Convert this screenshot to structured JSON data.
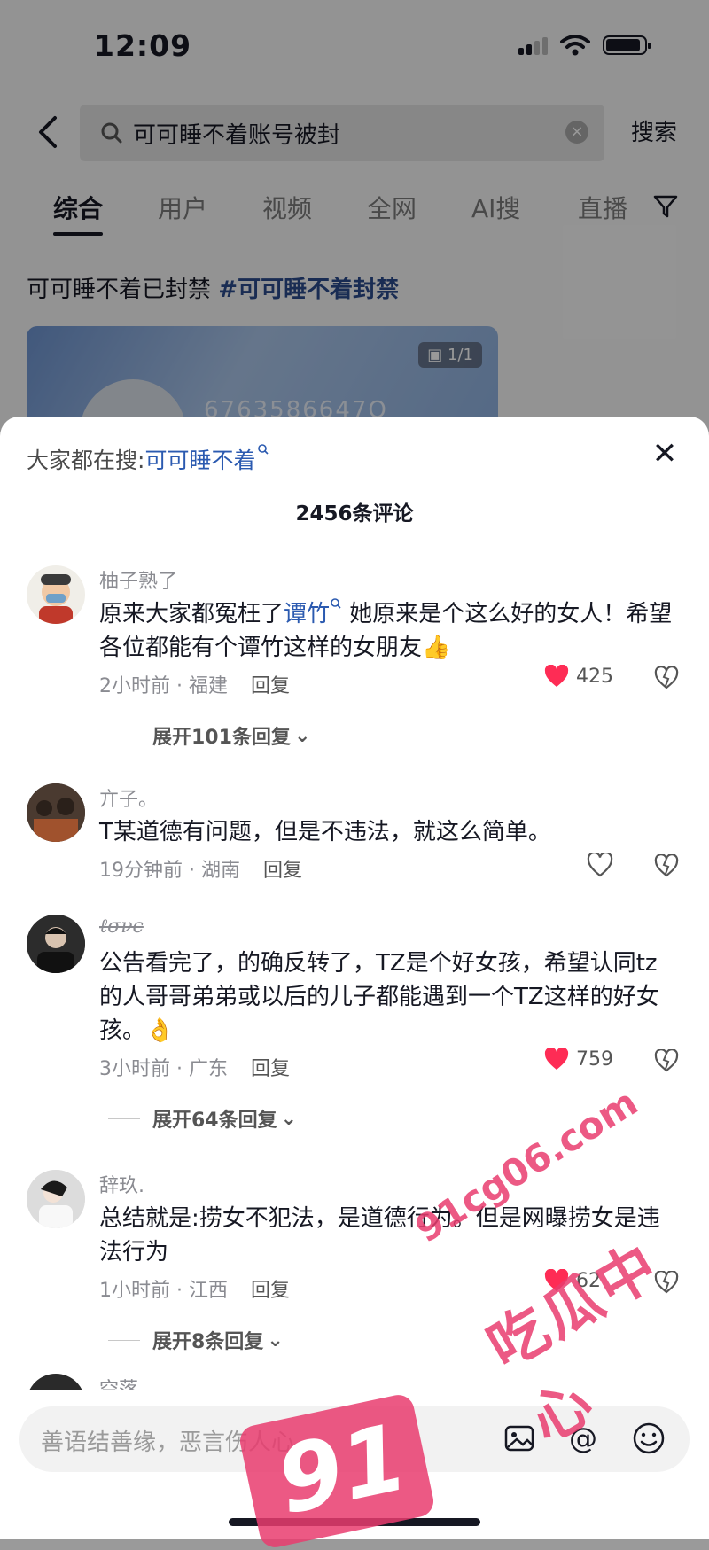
{
  "status_bar": {
    "time": "12:09"
  },
  "search": {
    "query": "可可睡不着账号被封",
    "submit_label": "搜索"
  },
  "tabs": [
    {
      "label": "综合"
    },
    {
      "label": "用户"
    },
    {
      "label": "视频"
    },
    {
      "label": "全网"
    },
    {
      "label": "AI搜"
    },
    {
      "label": "直播"
    }
  ],
  "background_post": {
    "text": "可可睡不着已封禁",
    "hashtag": "#可可睡不着封禁",
    "image_badge": "1/1",
    "image_number": "6763586647Q"
  },
  "sheet": {
    "trending_prefix": "大家都在搜:",
    "trending_keyword": "可可睡不着",
    "comment_count": "2456条评论"
  },
  "comments": [
    {
      "name": "柚子熟了",
      "text_before": "原来大家都冤枉了",
      "link": "谭竹",
      "text_after": " 她原来是个这么好的女人！希望各位都能有个谭竹这样的女朋友👍",
      "meta": "2小时前 · 福建",
      "reply": "回复",
      "likes": "425",
      "liked": true,
      "expand": "展开101条回复"
    },
    {
      "name": "亣子。",
      "text": "T某道德有问题，但是不违法，就这么简单。",
      "meta": "19分钟前 · 湖南",
      "reply": "回复",
      "likes": "",
      "liked": false
    },
    {
      "name": "ℓσνє",
      "text": "公告看完了，的确反转了，TZ是个好女孩，希望认同tz的人哥哥弟弟或以后的儿子都能遇到一个TZ这样的好女孩。👌",
      "meta": "3小时前 · 广东",
      "reply": "回复",
      "likes": "759",
      "liked": true,
      "expand": "展开64条回复"
    },
    {
      "name": "辞玖.",
      "text": "总结就是:捞女不犯法，是道德行为。但是网曝捞女是违法行为",
      "meta": "1小时前 · 江西",
      "reply": "回复",
      "likes": "62",
      "liked": true,
      "expand": "展开8条回复"
    },
    {
      "name": "空落"
    }
  ],
  "input": {
    "placeholder": "善语结善缘，恶言伤人心"
  },
  "watermark": {
    "site": "91cg06.com",
    "name": "吃瓜中心",
    "badge": "91"
  },
  "colors": {
    "accent_like": "#fe2c55",
    "link": "#2b5ab0",
    "watermark": "#e93c6e"
  }
}
